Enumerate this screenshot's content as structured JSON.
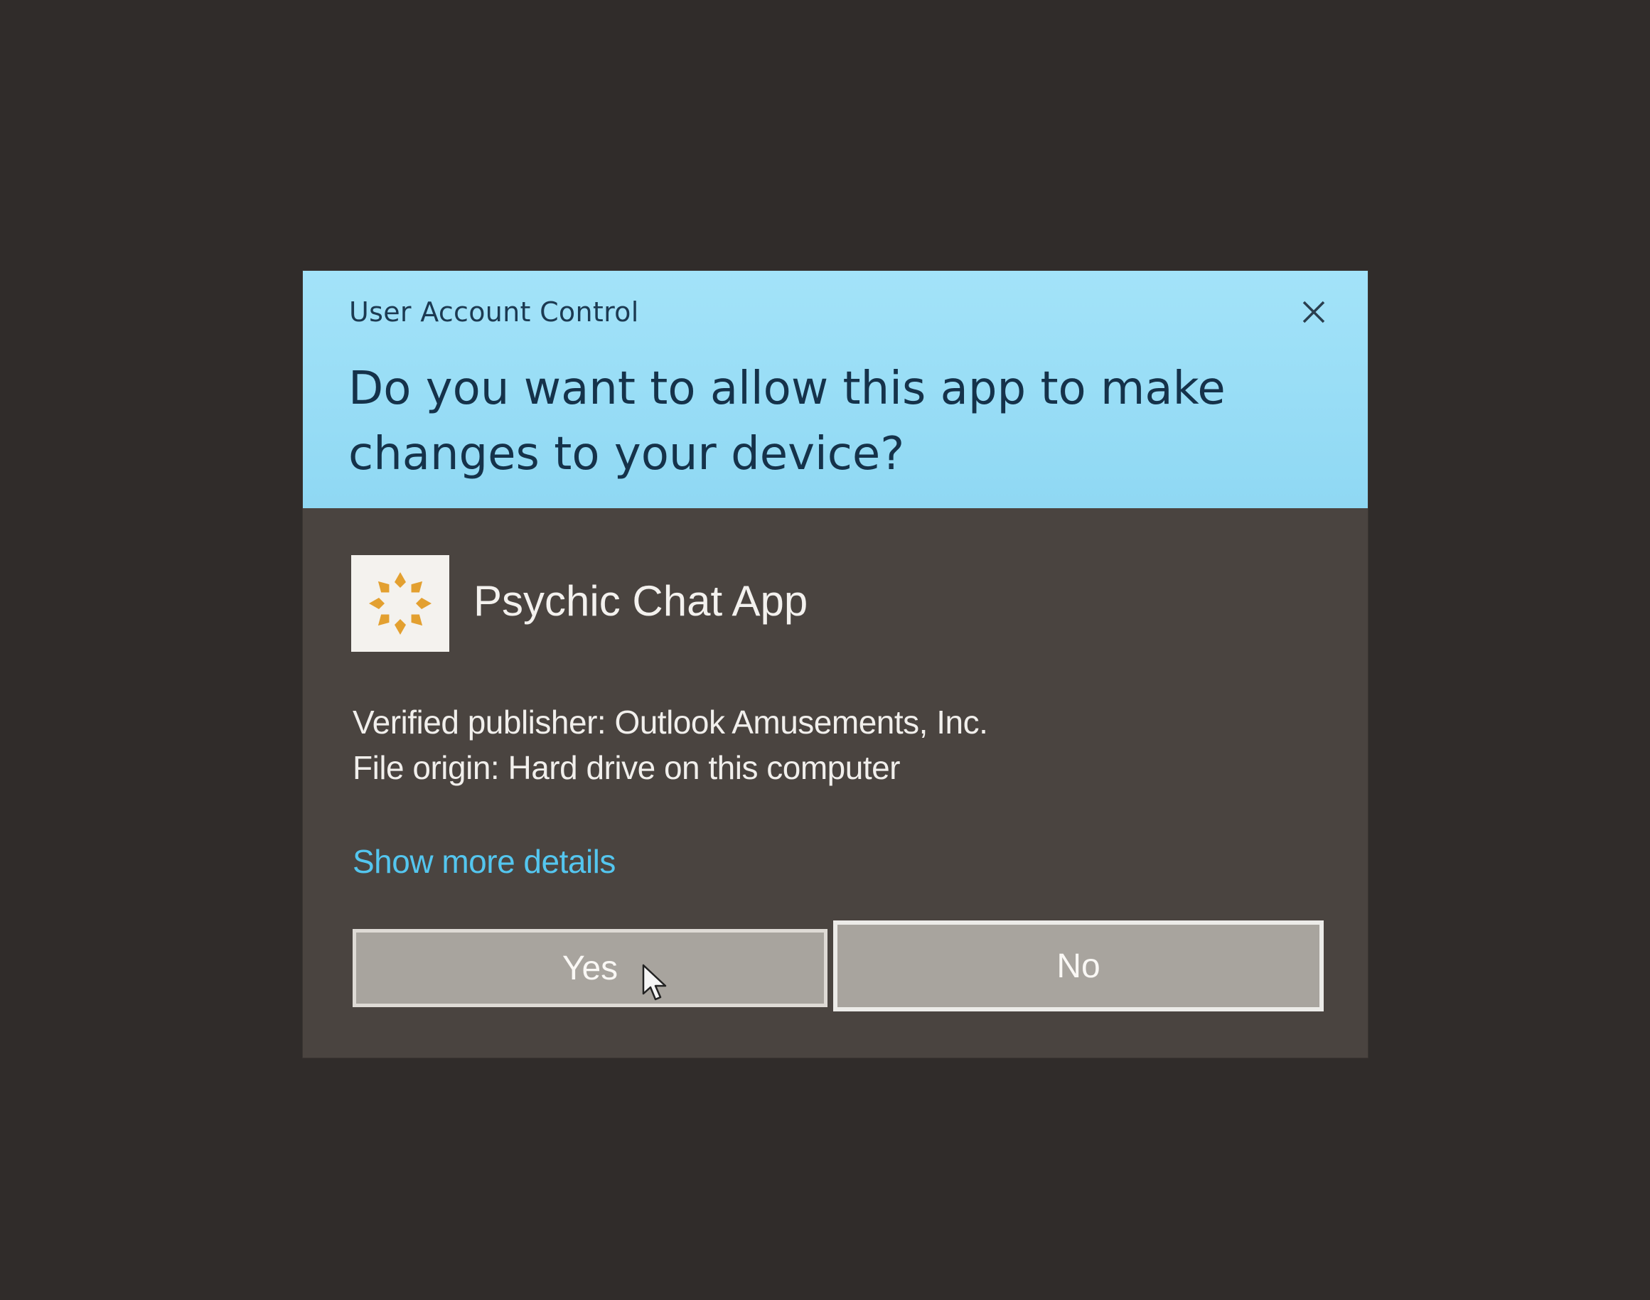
{
  "dialog": {
    "title": "User Account Control",
    "question": "Do you want to allow this app to make changes to your device?",
    "close_icon": "close-icon"
  },
  "app": {
    "name": "Psychic Chat App",
    "icon": "sun-burst-icon",
    "publisher_line": "Verified publisher: Outlook Amusements, Inc.",
    "origin_line": "File origin: Hard drive on this computer"
  },
  "details_link": "Show more details",
  "buttons": {
    "yes": "Yes",
    "no": "No"
  },
  "colors": {
    "header_bg": "#9adcf5",
    "body_bg": "#4a4440",
    "link": "#54c6ef",
    "icon_accent": "#e3a030"
  }
}
